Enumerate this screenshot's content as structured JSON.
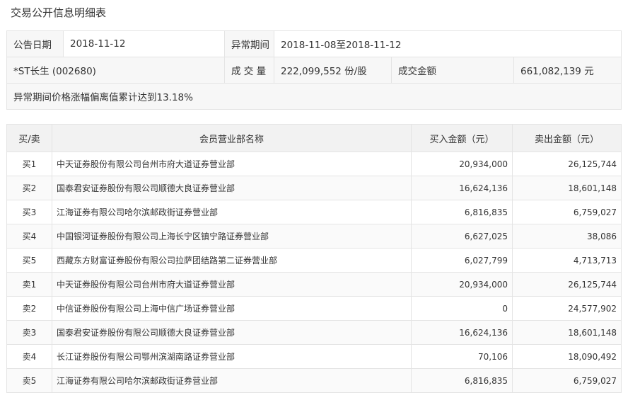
{
  "title": "交易公开信息明细表",
  "info": {
    "announce_date_label": "公告日期",
    "announce_date": "2018-11-12",
    "period_label": "异常期间",
    "period": "2018-11-08至2018-11-12",
    "stock": "*ST长生 (002680)",
    "volume_label": "成 交 量",
    "volume": "222,099,552 份/股",
    "amount_label": "成交金额",
    "amount": "661,082,139 元",
    "note": "异常期间价格涨幅偏离值累计达到13.18%"
  },
  "table": {
    "headers": [
      "买/卖",
      "会员营业部名称",
      "买入金额（元）",
      "卖出金额（元）"
    ],
    "rows": [
      {
        "side": "买1",
        "name": "中天证券股份有限公司台州市府大道证券营业部",
        "buy": "20,934,000",
        "sell": "26,125,744"
      },
      {
        "side": "买2",
        "name": "国泰君安证券股份有限公司顺德大良证券营业部",
        "buy": "16,624,136",
        "sell": "18,601,148"
      },
      {
        "side": "买3",
        "name": "江海证券有限公司哈尔滨邮政街证券营业部",
        "buy": "6,816,835",
        "sell": "6,759,027"
      },
      {
        "side": "买4",
        "name": "中国银河证券股份有限公司上海长宁区镇宁路证券营业部",
        "buy": "6,627,025",
        "sell": "38,086"
      },
      {
        "side": "买5",
        "name": "西藏东方财富证券股份有限公司拉萨团结路第二证券营业部",
        "buy": "6,027,799",
        "sell": "4,713,713"
      },
      {
        "side": "卖1",
        "name": "中天证券股份有限公司台州市府大道证券营业部",
        "buy": "20,934,000",
        "sell": "26,125,744"
      },
      {
        "side": "卖2",
        "name": "中信证券股份有限公司上海中信广场证券营业部",
        "buy": "0",
        "sell": "24,577,902"
      },
      {
        "side": "卖3",
        "name": "国泰君安证券股份有限公司顺德大良证券营业部",
        "buy": "16,624,136",
        "sell": "18,601,148"
      },
      {
        "side": "卖4",
        "name": "长江证券股份有限公司鄂州滨湖南路证券营业部",
        "buy": "70,106",
        "sell": "18,090,492"
      },
      {
        "side": "卖5",
        "name": "江海证券有限公司哈尔滨邮政街证券营业部",
        "buy": "6,816,835",
        "sell": "6,759,027"
      }
    ]
  }
}
